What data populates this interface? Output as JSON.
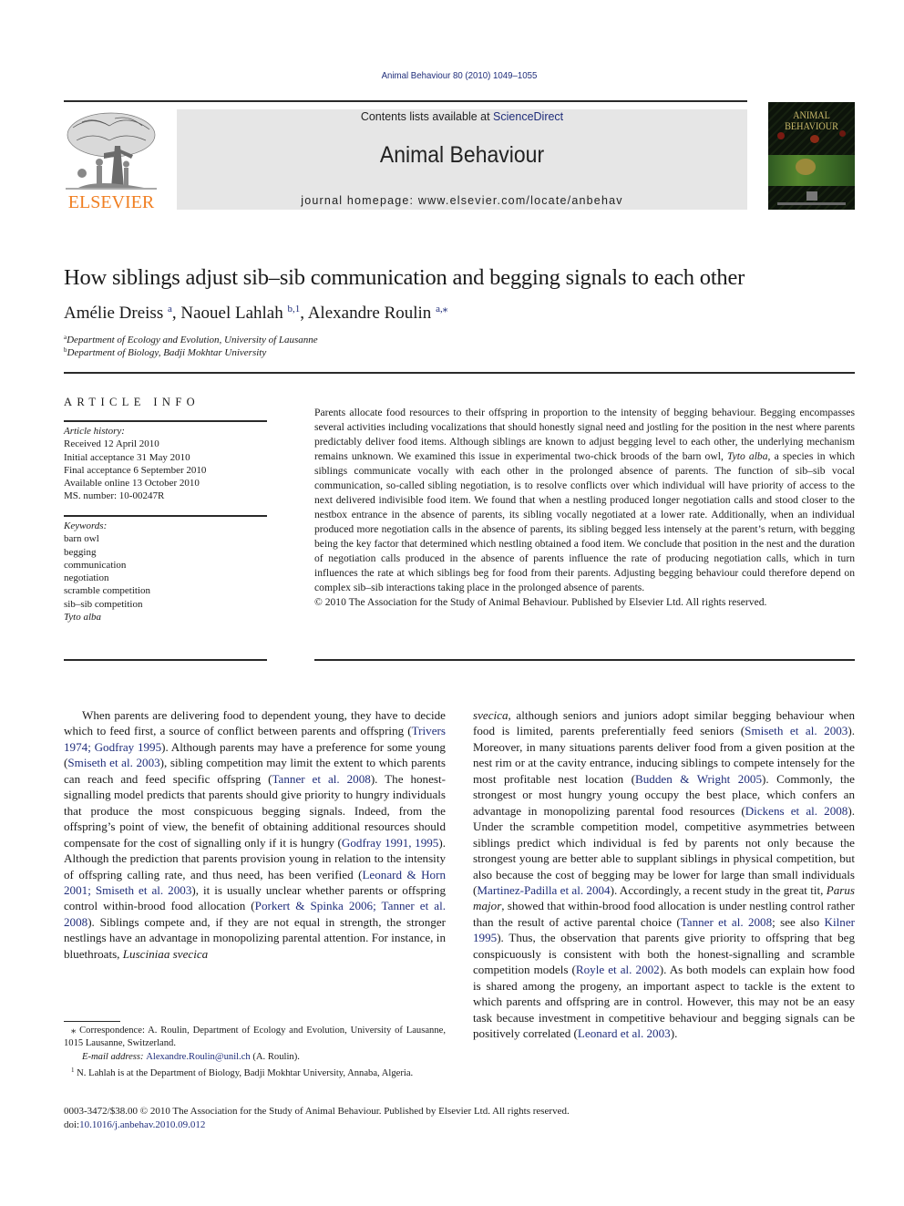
{
  "journal": {
    "citation": "Animal Behaviour 80 (2010) 1049–1055",
    "contents_prefix": "Contents lists available at ",
    "contents_link": "ScienceDirect",
    "title": "Animal Behaviour",
    "homepage": "journal homepage: www.elsevier.com/locate/anbehav",
    "publisher_logo_text": "ELSEVIER",
    "cover_title_line1": "ANIMAL",
    "cover_title_line2": "BEHAVIOUR",
    "colors": {
      "link": "#1f2d7a",
      "elsevier_orange": "#f07f22",
      "banner_bg": "#e6e6e6"
    }
  },
  "article": {
    "title": "How siblings adjust sib–sib communication and begging signals to each other",
    "authors": [
      {
        "name": "Amélie Dreiss",
        "sup": "a"
      },
      {
        "name": "Naouel Lahlah",
        "sup": "b,1"
      },
      {
        "name": "Alexandre Roulin",
        "sup": "a,⁎"
      }
    ],
    "affiliations": [
      {
        "mark": "a",
        "text": "Department of Ecology and Evolution, University of Lausanne"
      },
      {
        "mark": "b",
        "text": "Department of Biology, Badji Mokhtar University"
      }
    ]
  },
  "article_info": {
    "heading": "ARTICLE INFO",
    "history_label": "Article history:",
    "history": [
      "Received 12 April 2010",
      "Initial acceptance 31 May 2010",
      "Final acceptance 6 September 2010",
      "Available online 13 October 2010",
      "MS. number: 10-00247R"
    ],
    "keywords_label": "Keywords:",
    "keywords": [
      "barn owl",
      "begging",
      "communication",
      "negotiation",
      "scramble competition",
      "sib–sib competition",
      "Tyto alba"
    ]
  },
  "abstract": {
    "p1": "Parents allocate food resources to their offspring in proportion to the intensity of begging behaviour. Begging encompasses several activities including vocalizations that should honestly signal need and jostling for the position in the nest where parents predictably deliver food items. Although siblings are known to adjust begging level to each other, the underlying mechanism remains unknown. We examined this issue in experimental two-chick broods of the barn owl, ",
    "species": "Tyto alba",
    "p2": ", a species in which siblings communicate vocally with each other in the prolonged absence of parents. The function of sib–sib vocal communication, so-called sibling negotiation, is to resolve conflicts over which individual will have priority of access to the next delivered indivisible food item. We found that when a nestling produced longer negotiation calls and stood closer to the nestbox entrance in the absence of parents, its sibling vocally negotiated at a lower rate. Additionally, when an individual produced more negotiation calls in the absence of parents, its sibling begged less intensely at the parent’s return, with begging being the key factor that determined which nestling obtained a food item. We conclude that position in the nest and the duration of negotiation calls produced in the absence of parents influence the rate of producing negotiation calls, which in turn influences the rate at which siblings beg for food from their parents. Adjusting begging behaviour could therefore depend on complex sib–sib interactions taking place in the prolonged absence of parents.",
    "copyright": "© 2010 The Association for the Study of Animal Behaviour. Published by Elsevier Ltd. All rights reserved."
  },
  "body": {
    "left": [
      {
        "t": "When parents are delivering food to dependent young, they have to decide which to feed first, a source of conflict between parents and offspring ("
      },
      {
        "t": "Trivers 1974; Godfray 1995",
        "link": true
      },
      {
        "t": "). Although parents may have a preference for some young ("
      },
      {
        "t": "Smiseth et al. 2003",
        "link": true
      },
      {
        "t": "), sibling competition may limit the extent to which parents can reach and feed specific offspring ("
      },
      {
        "t": "Tanner et al. 2008",
        "link": true
      },
      {
        "t": "). The honest-signalling model predicts that parents should give priority to hungry individuals that produce the most conspicuous begging signals. Indeed, from the offspring’s point of view, the benefit of obtaining additional resources should compensate for the cost of signalling only if it is hungry ("
      },
      {
        "t": "Godfray 1991, 1995",
        "link": true
      },
      {
        "t": "). Although the prediction that parents provision young in relation to the intensity of offspring calling rate, and thus need, has been verified ("
      },
      {
        "t": "Leonard & Horn 2001; Smiseth et al. 2003",
        "link": true
      },
      {
        "t": "), it is usually unclear whether parents or offspring control within-brood food allocation ("
      },
      {
        "t": "Porkert & Spinka 2006; Tanner et al. 2008",
        "link": true
      },
      {
        "t": "). Siblings compete and, if they are not equal in strength, the stronger nestlings have an advantage in monopolizing parental attention. For instance, in bluethroats, "
      },
      {
        "t": "Lusciniaa svecica",
        "italic": true
      }
    ],
    "right": [
      {
        "t": "svecica",
        "italic": true
      },
      {
        "t": ", although seniors and juniors adopt similar begging behaviour when food is limited, parents preferentially feed seniors ("
      },
      {
        "t": "Smiseth et al. 2003",
        "link": true
      },
      {
        "t": "). Moreover, in many situations parents deliver food from a given position at the nest rim or at the cavity entrance, inducing siblings to compete intensely for the most profitable nest location ("
      },
      {
        "t": "Budden & Wright 2005",
        "link": true
      },
      {
        "t": "). Commonly, the strongest or most hungry young occupy the best place, which confers an advantage in monopolizing parental food resources ("
      },
      {
        "t": "Dickens et al. 2008",
        "link": true
      },
      {
        "t": "). Under the scramble competition model, competitive asymmetries between siblings predict which individual is fed by parents not only because the strongest young are better able to supplant siblings in physical competition, but also because the cost of begging may be lower for large than small individuals ("
      },
      {
        "t": "Martinez-Padilla et al. 2004",
        "link": true
      },
      {
        "t": "). Accordingly, a recent study in the great tit, "
      },
      {
        "t": "Parus major",
        "italic": true
      },
      {
        "t": ", showed that within-brood food allocation is under nestling control rather than the result of active parental choice ("
      },
      {
        "t": "Tanner et al. 2008",
        "link": true
      },
      {
        "t": "; see also "
      },
      {
        "t": "Kilner 1995",
        "link": true
      },
      {
        "t": "). Thus, the observation that parents give priority to offspring that beg conspicuously is consistent with both the honest-signalling and scramble competition models ("
      },
      {
        "t": "Royle et al. 2002",
        "link": true
      },
      {
        "t": "). As both models can explain how food is shared among the progeny, an important aspect to tackle is the extent to which parents and offspring are in control. However, this may not be an easy task because investment in competitive behaviour and begging signals can be positively correlated ("
      },
      {
        "t": "Leonard et al. 2003",
        "link": true
      },
      {
        "t": ")."
      }
    ]
  },
  "footnotes": {
    "corr_mark": "⁎",
    "corr_text": " Correspondence: A. Roulin, Department of Ecology and Evolution, University of Lausanne, 1015 Lausanne, Switzerland.",
    "email_label": "E-mail address: ",
    "email": "Alexandre.Roulin@unil.ch",
    "email_suffix": " (A. Roulin).",
    "note1_mark": "1",
    "note1_text": " N. Lahlah is at the Department of Biology, Badji Mokhtar University, Annaba, Algeria."
  },
  "bottom": {
    "issn_line": "0003-3472/$38.00 © 2010 The Association for the Study of Animal Behaviour. Published by Elsevier Ltd. All rights reserved.",
    "doi_prefix": "doi:",
    "doi": "10.1016/j.anbehav.2010.09.012"
  }
}
